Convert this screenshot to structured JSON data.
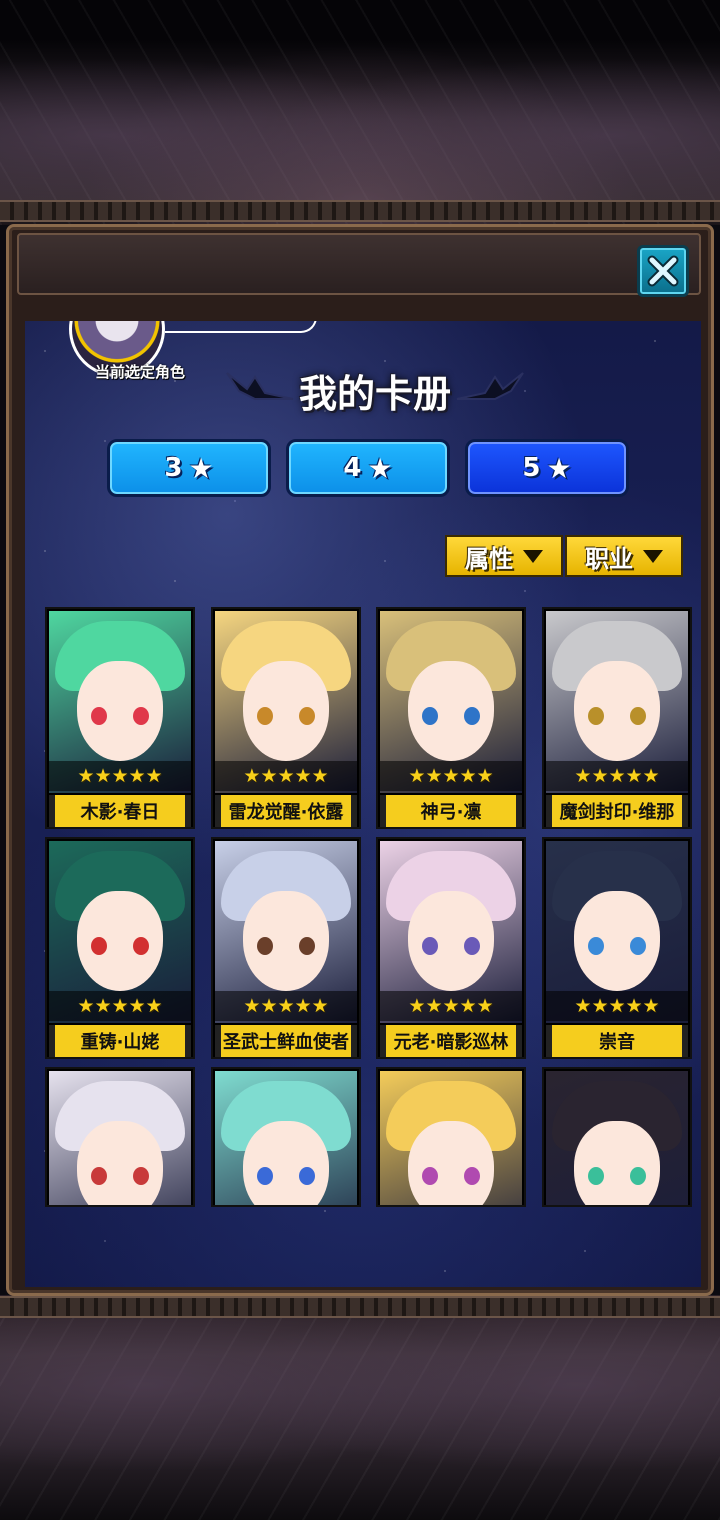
{
  "header": {
    "close_icon": "close-x-icon"
  },
  "selected_role_label": "当前选定角色",
  "page_title": "我的卡册",
  "filter_tabs": [
    {
      "label": "3",
      "icon": "★"
    },
    {
      "label": "4",
      "icon": "★"
    },
    {
      "label": "5",
      "icon": "★",
      "active": true
    }
  ],
  "sort_buttons": [
    {
      "label": "属性"
    },
    {
      "label": "职业"
    }
  ],
  "cards": [
    {
      "name": "木影·春日",
      "stars": "★★★★★",
      "hair": "#4fd7a0",
      "eye": "#e0384a"
    },
    {
      "name": "雷龙觉醒·依露",
      "stars": "★★★★★",
      "hair": "#f6d680",
      "eye": "#c8892a"
    },
    {
      "name": "神弓·凛",
      "stars": "★★★★★",
      "hair": "#d9c07a",
      "eye": "#2e74c8"
    },
    {
      "name": "魔剑封印·维那",
      "stars": "★★★★★",
      "hair": "#c9c9cc",
      "eye": "#b9902a"
    },
    {
      "name": "重铸·山姥",
      "stars": "★★★★★",
      "hair": "#1c6a5a",
      "eye": "#d23030"
    },
    {
      "name": "圣武士鲜血使者",
      "stars": "★★★★★",
      "hair": "#c8d0e8",
      "eye": "#6a3f2a"
    },
    {
      "name": "元老·暗影巡林",
      "stars": "★★★★★",
      "hair": "#ecd2e6",
      "eye": "#6a5ab8"
    },
    {
      "name": "崇音",
      "stars": "★★★★★",
      "hair": "#27304a",
      "eye": "#3a8ad8"
    },
    {
      "name": "",
      "stars": "",
      "hair": "#e6e2ee",
      "eye": "#c83a3a"
    },
    {
      "name": "",
      "stars": "",
      "hair": "#7fdcd0",
      "eye": "#3a6ad8"
    },
    {
      "name": "",
      "stars": "",
      "hair": "#f4cc5a",
      "eye": "#b04ab0"
    },
    {
      "name": "",
      "stars": "",
      "hair": "#2a2430",
      "eye": "#3abf9a"
    }
  ]
}
